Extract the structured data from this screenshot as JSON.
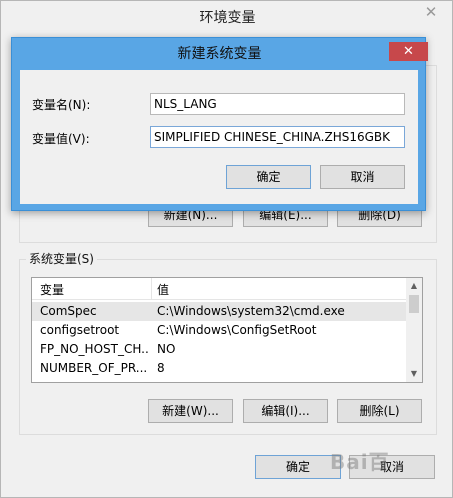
{
  "window": {
    "title": "环境变量",
    "close_glyph": "✕"
  },
  "user_vars": {
    "new_label": "新建(N)...",
    "edit_label": "编辑(E)...",
    "delete_label": "删除(D)"
  },
  "system_vars": {
    "group_label": "系统变量(S)",
    "columns": [
      "变量",
      "值"
    ],
    "rows": [
      {
        "name": "ComSpec",
        "value": "C:\\Windows\\system32\\cmd.exe"
      },
      {
        "name": "configsetroot",
        "value": "C:\\Windows\\ConfigSetRoot"
      },
      {
        "name": "FP_NO_HOST_CH...",
        "value": "NO"
      },
      {
        "name": "NUMBER_OF_PR...",
        "value": "8"
      }
    ],
    "new_label": "新建(W)...",
    "edit_label": "编辑(I)...",
    "delete_label": "删除(L)"
  },
  "footer": {
    "ok_label": "确定",
    "cancel_label": "取消"
  },
  "dialog": {
    "title": "新建系统变量",
    "close_glyph": "✕",
    "name_label": "变量名(N):",
    "name_value": "NLS_LANG",
    "value_label": "变量值(V):",
    "value_value": "SIMPLIFIED CHINESE_CHINA.ZHS16GBK",
    "ok_label": "确定",
    "cancel_label": "取消"
  },
  "watermark": "Bai百"
}
